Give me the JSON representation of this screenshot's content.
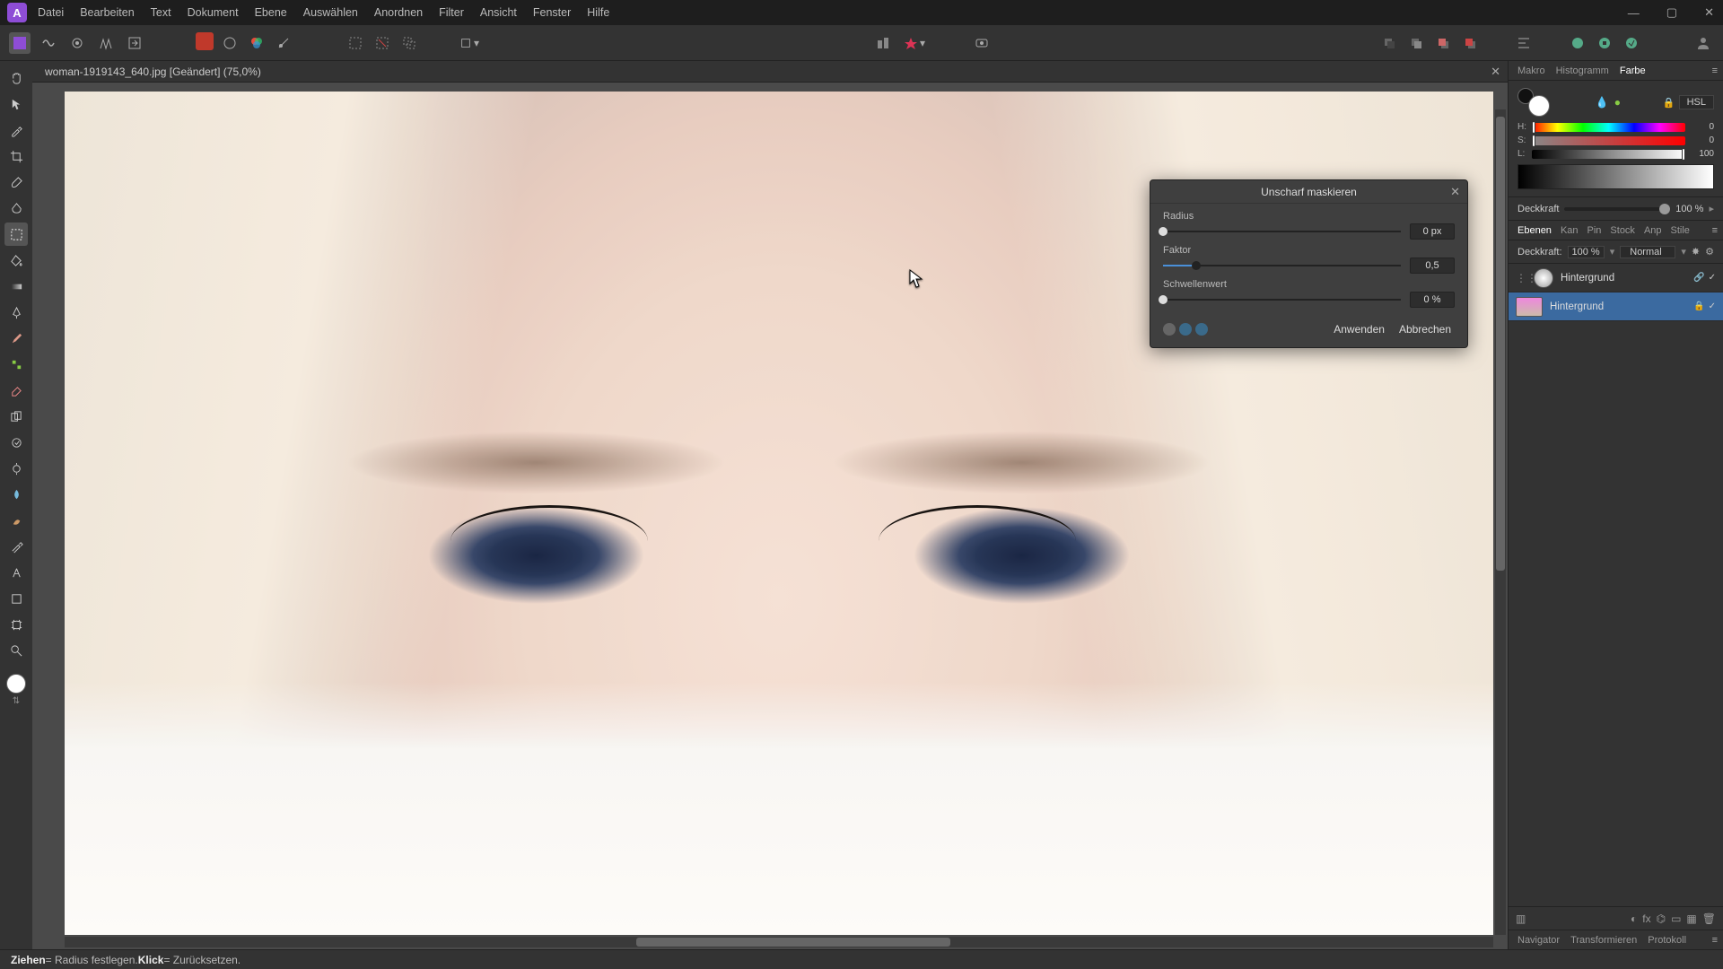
{
  "menu": {
    "items": [
      "Datei",
      "Bearbeiten",
      "Text",
      "Dokument",
      "Ebene",
      "Auswählen",
      "Anordnen",
      "Filter",
      "Ansicht",
      "Fenster",
      "Hilfe"
    ]
  },
  "app": {
    "logo": "A"
  },
  "document": {
    "tab_label": "woman-1919143_640.jpg [Geändert] (75,0%)"
  },
  "dialog": {
    "title": "Unscharf maskieren",
    "radius": {
      "label": "Radius",
      "value": "0 px",
      "percent": 0
    },
    "factor": {
      "label": "Faktor",
      "value": "0,5",
      "percent": 14
    },
    "threshold": {
      "label": "Schwellenwert",
      "value": "0 %",
      "percent": 0
    },
    "apply": "Anwenden",
    "cancel": "Abbrechen"
  },
  "right": {
    "tabs": {
      "makro": "Makro",
      "histogramm": "Histogramm",
      "farbe": "Farbe"
    },
    "color": {
      "mode": "HSL",
      "lock": "🔒",
      "h": {
        "label": "H:",
        "value": "0"
      },
      "s": {
        "label": "S:",
        "value": "0"
      },
      "l": {
        "label": "L:",
        "value": "100"
      }
    },
    "opacity": {
      "label": "Deckkraft",
      "value": "100 %"
    },
    "layer_tabs": {
      "ebenen": "Ebenen",
      "kan": "Kan",
      "pin": "Pin",
      "stock": "Stock",
      "anp": "Anp",
      "stile": "Stile"
    },
    "layer_ctrl": {
      "deckkraft": "Deckkraft:",
      "deck_val": "100 %",
      "blend": "Normal"
    },
    "layers": [
      {
        "name": "Hintergrund",
        "selected": false,
        "adjust": true
      },
      {
        "name": "Hintergrund",
        "selected": true,
        "adjust": false
      }
    ],
    "nav_tabs": {
      "navigator": "Navigator",
      "transformieren": "Transformieren",
      "protokoll": "Protokoll"
    }
  },
  "statusbar": {
    "drag": "Ziehen",
    "drag_desc": " = Radius festlegen. ",
    "click": "Klick",
    "click_desc": " = Zurücksetzen."
  }
}
